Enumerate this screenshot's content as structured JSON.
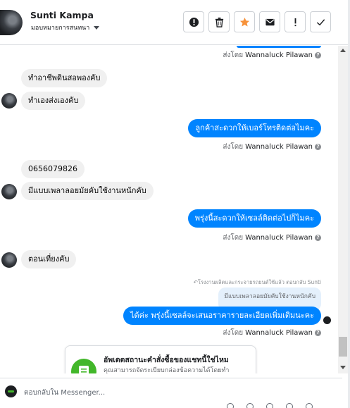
{
  "header": {
    "contact_name": "Sunti Kampa",
    "assignee_label": "มอบหมายการสนทนา",
    "toolbar": [
      {
        "name": "spam-button",
        "icon": "alert-circle-icon"
      },
      {
        "name": "delete-button",
        "icon": "trash-icon"
      },
      {
        "name": "star-button",
        "icon": "star-icon"
      },
      {
        "name": "mark-unread-button",
        "icon": "envelope-icon"
      },
      {
        "name": "follow-up-button",
        "icon": "exclamation-icon"
      },
      {
        "name": "done-button",
        "icon": "checkmark-icon"
      }
    ]
  },
  "thread": {
    "sent_by_prefix": "ส่งโดย",
    "agent_name": "Wannaluck Pilawan",
    "messages": [
      {
        "dir": "in",
        "text": "ทำอาชีพดินสอพองคับ"
      },
      {
        "dir": "in",
        "text": "ทำเองส่งเองคับ"
      },
      {
        "dir": "out",
        "text": "ลูกค้าสะดวกให้เบอร์โทรติดต่อไมคะ"
      },
      {
        "dir": "in",
        "text": "0656079826"
      },
      {
        "dir": "in",
        "text": "มีแบบเพลาลอยมัยคับใช้งานหนักคับ"
      },
      {
        "dir": "out",
        "text": "พรุ่งนี้สะดวกให้เซลล์ติดต่อไปก็ไมคะ"
      },
      {
        "dir": "in",
        "text": "ตอนเที่ยงคับ"
      },
      {
        "dir": "out",
        "text": "ได้ค่ะ พรุ่งนี้เซลล์จะเสนอราคารายละเอียดเพิ่มเติมนะคะ"
      }
    ],
    "reply_note": "↶โรงงานผลิตและกระจายรถยนต์ใช้แล้ว ตอบกลับ Sunti",
    "quoted_text": "มีแบบเพลาลอยมัยคับใช้งานหนักคับ"
  },
  "order_card": {
    "title": "อัพเดตสถานะคำสั่งซื้อของแชทนี้ใช่ไหม",
    "subtitle": "คุณสามารถจัดระเบียบกล่องข้อความได้โดยทำ",
    "icon": "receipt-icon"
  },
  "composer": {
    "placeholder": "ตอบกลับใน Messenger..."
  },
  "colors": {
    "outgoing_bubble": "#0084ff",
    "incoming_bubble": "#f0f0f0",
    "star": "#f7923a",
    "card_icon": "#42b72a"
  }
}
